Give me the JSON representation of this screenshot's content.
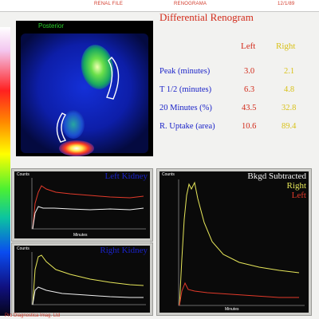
{
  "header": {
    "study": "RENAL FILE",
    "mode": "RENOGRAMA",
    "date": "12/1/89"
  },
  "scan": {
    "label": "Posterior"
  },
  "title": "Differential Renogram",
  "columns": {
    "left": "Left",
    "right": "Right"
  },
  "metrics": [
    {
      "label": "Peak (minutes)",
      "left": "3.0",
      "right": "2.1"
    },
    {
      "label": "T 1/2 (minutes)",
      "left": "6.3",
      "right": "4.8"
    },
    {
      "label": "20 Minutes (%)",
      "left": "43.5",
      "right": "32.8"
    },
    {
      "label": "R. Uptake (area)",
      "left": "10.6",
      "right": "89.4"
    }
  ],
  "panels": {
    "left_kidney": {
      "title": "Left Kidney",
      "y_label": "Counts",
      "x_label": "Minutes"
    },
    "right_kidney": {
      "title": "Right Kidney",
      "y_label": "Counts",
      "x_label": "Minutes"
    },
    "subtracted": {
      "title": "Bkgd Subtracted",
      "legend_right": "Right",
      "legend_left": "Left",
      "y_label": "Counts",
      "x_label": "Minutes"
    }
  },
  "footer": "Pro Diagnostica Imag. Ltd",
  "colors": {
    "left_series": "#e23a2a",
    "right_series": "#e6e65a",
    "label_blue": "#1a22c8",
    "label_red": "#d22a1a",
    "label_yellow": "#e6e65a"
  }
}
